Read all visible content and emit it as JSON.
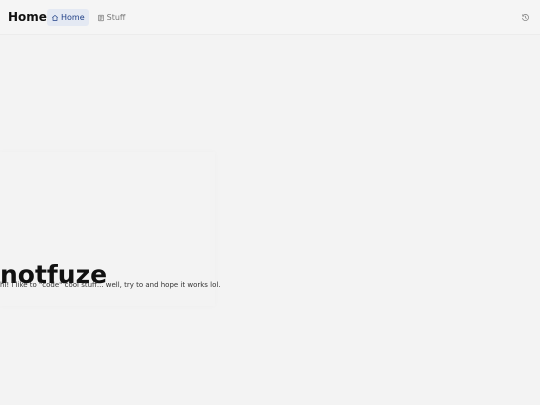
{
  "header": {
    "brand": "Home",
    "nav": [
      {
        "label": "Home",
        "icon": "home-icon",
        "active": true
      },
      {
        "label": "Stuff",
        "icon": "document-icon",
        "active": false
      }
    ],
    "right_icon": "history-icon"
  },
  "hero": {
    "title": "notfuze",
    "description": "hi! i like to \"code\" cool stuff... well, try to and hope it works lol."
  },
  "colors": {
    "background": "#f3f3f3",
    "header_background": "#f5f5f5",
    "active_nav_background": "#e4e9f3",
    "active_nav_text": "#1f3f86",
    "text_primary": "#111111",
    "text_muted": "#777777"
  }
}
